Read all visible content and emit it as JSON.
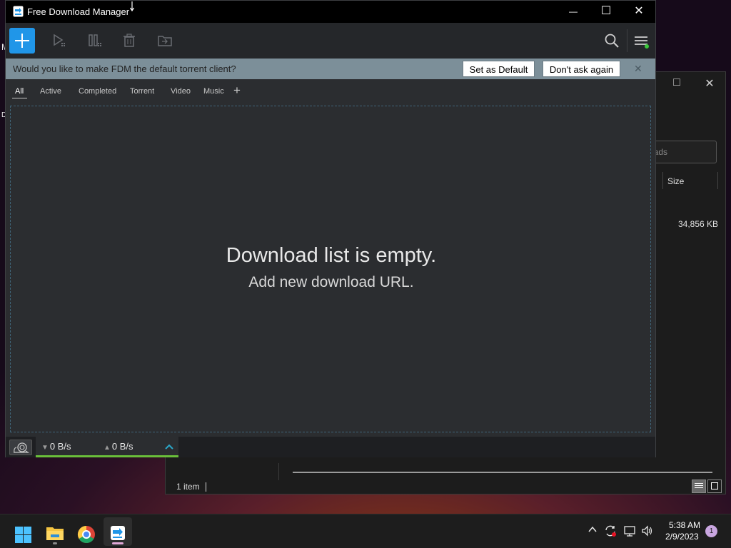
{
  "desktop": {
    "frag_m": "M",
    "frag_d": "D"
  },
  "explorer": {
    "search_placeholder": "oads",
    "column_size": "Size",
    "file_size": "34,856 KB",
    "status_items": "1 item",
    "minimize_glyph": "□",
    "close_glyph": "✕"
  },
  "fdm": {
    "title": "Free Download Manager",
    "window_controls": {
      "minimize": "—",
      "maximize": "☐",
      "close": "✕"
    },
    "banner": {
      "text": "Would you like to make FDM the default torrent client?",
      "set_default": "Set as Default",
      "dont_ask": "Don't ask again",
      "close": "✕"
    },
    "tabs": [
      "All",
      "Active",
      "Completed",
      "Torrent",
      "Video",
      "Music"
    ],
    "tab_add": "+",
    "empty_main": "Download list is empty.",
    "empty_sub": "Add new download URL.",
    "speed_down": "0 B/s",
    "speed_up": "0 B/s",
    "accent": "#2096e8",
    "speed_bar_color": "#6abf3a"
  },
  "taskbar": {
    "apps": [
      "start-icon",
      "file-explorer-icon",
      "chrome-icon",
      "fdm-icon"
    ],
    "time": "5:38 AM",
    "date": "2/9/2023",
    "notifications": "1"
  }
}
